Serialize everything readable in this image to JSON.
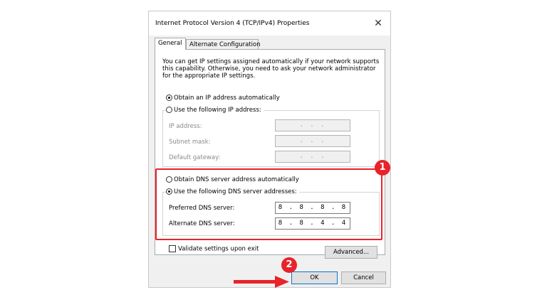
{
  "dialog": {
    "title": "Internet Protocol Version 4 (TCP/IPv4) Properties",
    "close_icon": "✕"
  },
  "tabs": [
    {
      "label": "General",
      "active": true
    },
    {
      "label": "Alternate Configuration",
      "active": false
    }
  ],
  "description": "You can get IP settings assigned automatically if your network supports this capability. Otherwise, you need to ask your network administrator for the appropriate IP settings.",
  "ip_section": {
    "auto_label": "Obtain an IP address automatically",
    "auto_selected": true,
    "manual_label": "Use the following IP address:",
    "manual_selected": false,
    "fields": [
      {
        "label": "IP address:",
        "value": ".   .   .",
        "enabled": false
      },
      {
        "label": "Subnet mask:",
        "value": ".   .   .",
        "enabled": false
      },
      {
        "label": "Default gateway:",
        "value": ".   .   .",
        "enabled": false
      }
    ]
  },
  "dns_section": {
    "auto_label": "Obtain DNS server address automatically",
    "auto_selected": false,
    "manual_label": "Use the following DNS server addresses:",
    "manual_selected": true,
    "fields": [
      {
        "label": "Preferred DNS server:",
        "value": "8 . 8 . 8 . 8",
        "enabled": true
      },
      {
        "label": "Alternate DNS server:",
        "value": "8 . 8 . 4 . 4",
        "enabled": true
      }
    ]
  },
  "validate_label": "Validate settings upon exit",
  "validate_checked": false,
  "advanced_label": "Advanced...",
  "ok_label": "OK",
  "cancel_label": "Cancel",
  "annotations": {
    "badge_1": "1",
    "badge_2": "2",
    "color": "#e8232a"
  }
}
